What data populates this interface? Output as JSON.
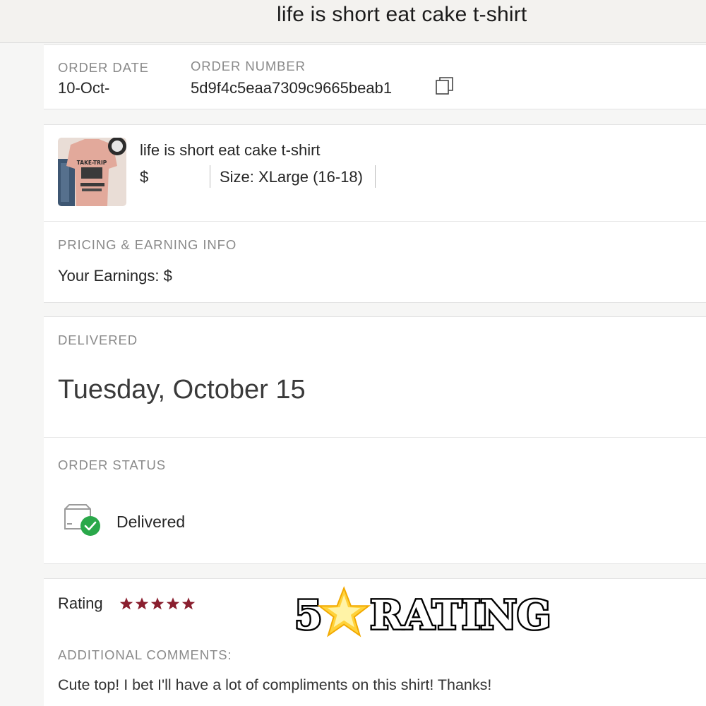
{
  "header": {
    "title": "life is short eat cake t-shirt"
  },
  "order": {
    "date_label": "ORDER DATE",
    "date_value": "10-Oct-",
    "number_label": "ORDER NUMBER",
    "number_value": "5d9f4c5eaa7309c9665beab1",
    "copy_icon": "copy-icon"
  },
  "item": {
    "title": "life is short eat cake t-shirt",
    "price": "$",
    "size": "Size: XLarge (16-18)",
    "thumbnail_text": "TAKE-TRIP",
    "pricing_label": "PRICING & EARNING INFO",
    "earnings": "Your Earnings: $"
  },
  "delivery": {
    "label": "DELIVERED",
    "date": "Tuesday, October 15",
    "status_label": "ORDER STATUS",
    "status_value": "Delivered",
    "status_icon": "package-delivered-icon",
    "status_color": "#2aa84a"
  },
  "rating": {
    "label": "Rating",
    "stars": 5,
    "star_color": "#8a1f2f",
    "overlay_prefix": "5",
    "overlay_text": "RATING",
    "comments_label": "ADDITIONAL COMMENTS:",
    "comment": "Cute top! I bet I'll have a lot of compliments on this shirt! Thanks!"
  }
}
